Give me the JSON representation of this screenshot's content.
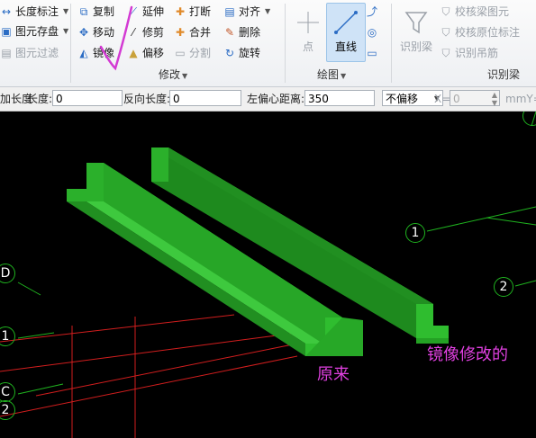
{
  "ribbon": {
    "left_col": [
      {
        "label": "长度标注",
        "icon": "dimension-icon",
        "dropdown": true
      },
      {
        "label": "图元存盘",
        "icon": "save-element-icon",
        "dropdown": true
      },
      {
        "label": "图元过滤",
        "icon": "filter-icon",
        "disabled": true
      }
    ],
    "modify": {
      "group_label": "修改",
      "col1": [
        {
          "label": "复制",
          "icon": "copy-icon"
        },
        {
          "label": "移动",
          "icon": "move-icon"
        },
        {
          "label": "镜像",
          "icon": "mirror-icon"
        }
      ],
      "col2": [
        {
          "label": "延伸",
          "icon": "extend-icon"
        },
        {
          "label": "修剪",
          "icon": "trim-icon"
        },
        {
          "label": "偏移",
          "icon": "offset-icon"
        }
      ],
      "col3": [
        {
          "label": "打断",
          "icon": "break-icon"
        },
        {
          "label": "合并",
          "icon": "merge-icon"
        },
        {
          "label": "分割",
          "icon": "split-icon",
          "disabled": true
        }
      ],
      "col4": [
        {
          "label": "对齐",
          "icon": "align-icon",
          "dropdown": true
        },
        {
          "label": "删除",
          "icon": "delete-icon"
        },
        {
          "label": "旋转",
          "icon": "rotate-icon"
        }
      ]
    },
    "draw": {
      "group_label": "绘图",
      "point_label": "点",
      "line_label": "直线"
    },
    "recognize": {
      "group_label": "识别梁",
      "big_label": "识别梁",
      "items": [
        {
          "label": "校核梁图元",
          "icon": "check-beam-icon"
        },
        {
          "label": "校核原位标注",
          "icon": "check-annotation-icon"
        },
        {
          "label": "识别吊筋",
          "icon": "hanger-icon"
        }
      ]
    }
  },
  "toolbar": {
    "length_label": "加长度",
    "length2_label": "长度:",
    "length_value": "0",
    "reverse_label": "反向长度:",
    "reverse_value": "0",
    "offset_label": "左偏心距离:",
    "offset_value": "350",
    "offset_mode": "不偏移",
    "x_label": "X=",
    "x_value": "0",
    "y_label": "mmY="
  },
  "canvas": {
    "axes": [
      "1",
      "2",
      "D",
      "1",
      "C",
      "2"
    ],
    "annotation_original": "原来",
    "annotation_mirrored": "镜像修改的",
    "beam_color": "#2db52d",
    "annotation_color": "#e040e0"
  }
}
